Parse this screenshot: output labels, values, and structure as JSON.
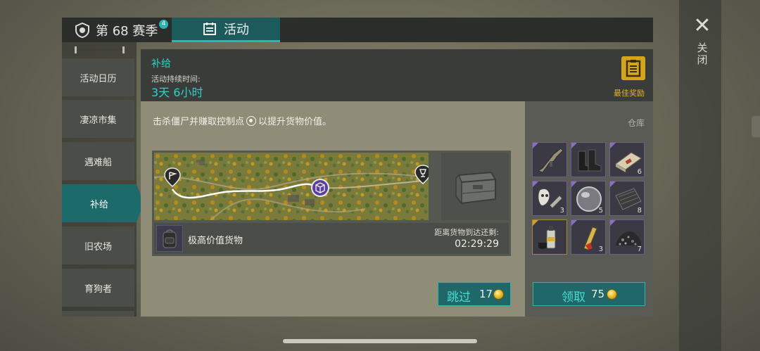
{
  "tabs": {
    "season_label": "第 68 赛季",
    "season_badge": "4",
    "activity_label": "活动"
  },
  "sidebar": {
    "items": [
      {
        "label": "活动日历",
        "active": false
      },
      {
        "label": "凄凉市集",
        "active": false
      },
      {
        "label": "遇难船",
        "active": false
      },
      {
        "label": "补给",
        "active": true
      },
      {
        "label": "旧农场",
        "active": false
      },
      {
        "label": "育狗者",
        "active": false
      }
    ]
  },
  "header": {
    "title": "补给",
    "duration_label": "活动持续时间:",
    "duration_value": "3天 6小时",
    "best_reward_label": "最佳奖励"
  },
  "content": {
    "description_before": "击杀僵尸并赚取控制点",
    "description_after": "以提升货物价值。",
    "route_progress": 0.68,
    "cargo_name": "极高价值货物",
    "arrival_label": "距离货物到达还剩:",
    "arrival_time": "02:29:29",
    "skip_label": "跳过",
    "skip_cost": "17"
  },
  "storage": {
    "label": "仓库",
    "items": [
      {
        "icon": "rifle-icon",
        "rarity": "purple",
        "qty": ""
      },
      {
        "icon": "boots-icon",
        "rarity": "purple",
        "qty": ""
      },
      {
        "icon": "bandage-kit-icon",
        "rarity": "purple",
        "qty": "6"
      },
      {
        "icon": "mask-wrench-icon",
        "rarity": "purple",
        "qty": "3"
      },
      {
        "icon": "lens-icon",
        "rarity": "purple",
        "qty": "5"
      },
      {
        "icon": "metal-sheet-icon",
        "rarity": "purple",
        "qty": "8"
      },
      {
        "icon": "spray-can-icon",
        "rarity": "gold",
        "qty": ""
      },
      {
        "icon": "pill-capsule-icon",
        "rarity": "purple",
        "qty": "3"
      },
      {
        "icon": "gravel-icon",
        "rarity": "purple",
        "qty": "7"
      }
    ],
    "claim_label": "领取",
    "claim_cost": "75"
  },
  "window": {
    "close_label": "关闭"
  },
  "colors": {
    "accent_teal": "#2ad4c8",
    "button_bg": "#1f6769",
    "gold": "#d4a51a",
    "purple_rarity": "#8a6fc0"
  }
}
